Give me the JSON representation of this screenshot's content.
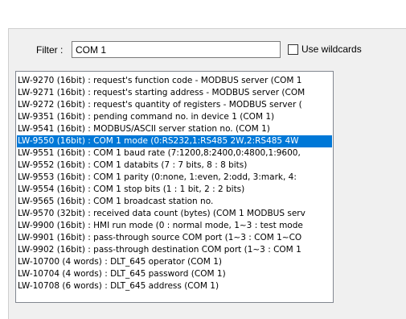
{
  "filter": {
    "label": "Filter :",
    "value": "COM 1"
  },
  "wildcards": {
    "label": "Use wildcards",
    "checked": false
  },
  "list": {
    "selected_index": 5,
    "items": [
      "LW-9270 (16bit) : request's function code - MODBUS server (COM 1",
      "LW-9271 (16bit) : request's starting address - MODBUS server (COM",
      "LW-9272 (16bit) : request's quantity of registers - MODBUS server (",
      "LW-9351 (16bit) : pending command no. in device 1 (COM 1)",
      "LW-9541 (16bit) : MODBUS/ASCII server station no. (COM 1)",
      "LW-9550 (16bit) : COM 1 mode (0:RS232,1:RS485 2W,2:RS485 4W",
      "LW-9551 (16bit) : COM 1 baud rate (7:1200,8:2400,0:4800,1:9600,",
      "LW-9552 (16bit) : COM 1 databits (7 : 7 bits, 8 : 8 bits)",
      "LW-9553 (16bit) : COM 1 parity (0:none, 1:even, 2:odd, 3:mark, 4:",
      "LW-9554 (16bit) : COM 1 stop bits (1 : 1 bit, 2 : 2 bits)",
      "LW-9565 (16bit) : COM 1 broadcast station no.",
      "LW-9570 (32bit) : received data count (bytes) (COM 1 MODBUS serv",
      "LW-9900 (16bit) : HMI run mode (0 : normal mode, 1~3 : test mode",
      "LW-9901 (16bit) : pass-through source COM port (1~3 : COM 1~CO",
      "LW-9902 (16bit) : pass-through destination COM port (1~3 : COM 1",
      "LW-10700 (4 words) : DLT_645 operator (COM 1)",
      "LW-10704 (4 words) : DLT_645 password (COM 1)",
      "LW-10708 (6 words) : DLT_645 address (COM 1)"
    ]
  },
  "colors": {
    "selection": "#0078d7",
    "panel": "#f0f0f0"
  }
}
